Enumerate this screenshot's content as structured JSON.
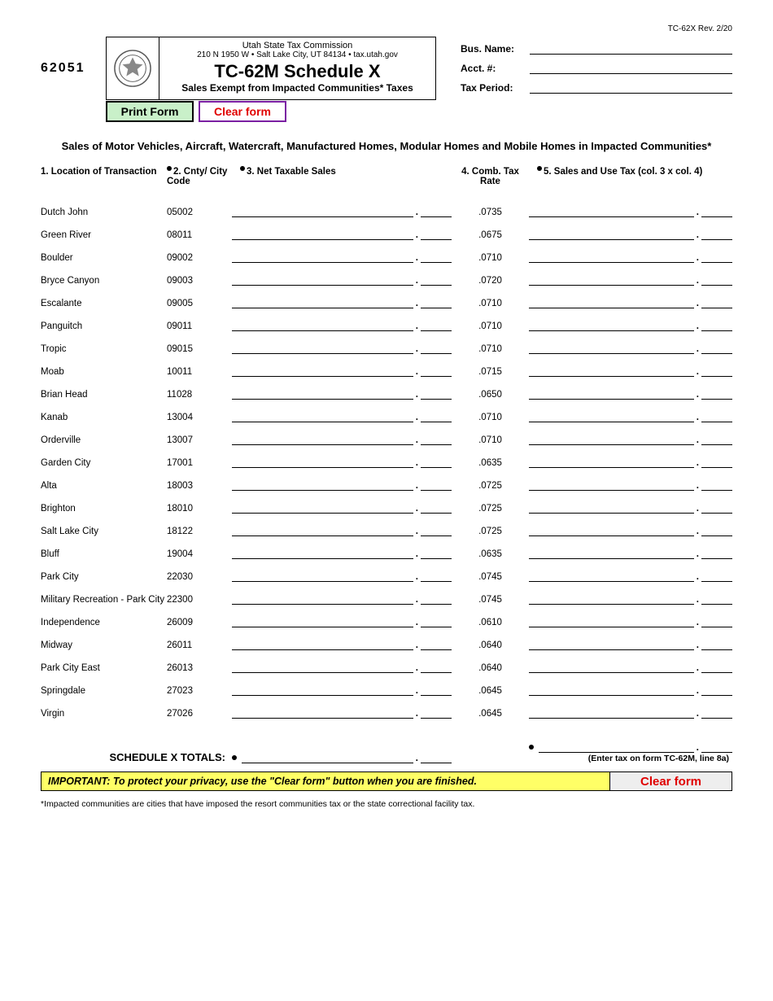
{
  "form_id_top": "TC-62X    Rev. 2/20",
  "left_code": "62051",
  "title": {
    "agency": "Utah State Tax Commission",
    "address": "210 N 1950 W  •  Salt Lake City, UT 84134  •  tax.utah.gov",
    "main": "TC-62M Schedule X",
    "sub": "Sales Exempt from Impacted Communities* Taxes"
  },
  "meta": {
    "bus_name_label": "Bus. Name:",
    "acct_label": "Acct. #:",
    "tax_period_label": "Tax Period:"
  },
  "buttons": {
    "print": "Print Form",
    "clear": "Clear form"
  },
  "section_title": "Sales of Motor Vehicles, Aircraft, Watercraft, Manufactured Homes, Modular Homes and Mobile Homes in Impacted Communities*",
  "columns": {
    "c1": "1. Location of Transaction",
    "c2": "2. Cnty/ City Code",
    "c3": "3. Net Taxable Sales",
    "c4": "4. Comb. Tax Rate",
    "c5": "5. Sales and Use Tax (col. 3 x col. 4)"
  },
  "rows": [
    {
      "loc": "Dutch John",
      "code": "05002",
      "rate": ".0735"
    },
    {
      "loc": "Green River",
      "code": "08011",
      "rate": ".0675"
    },
    {
      "loc": "Boulder",
      "code": "09002",
      "rate": ".0710"
    },
    {
      "loc": "Bryce Canyon",
      "code": "09003",
      "rate": ".0720"
    },
    {
      "loc": "Escalante",
      "code": "09005",
      "rate": ".0710"
    },
    {
      "loc": "Panguitch",
      "code": "09011",
      "rate": ".0710"
    },
    {
      "loc": "Tropic",
      "code": "09015",
      "rate": ".0710"
    },
    {
      "loc": "Moab",
      "code": "10011",
      "rate": ".0715"
    },
    {
      "loc": "Brian Head",
      "code": "11028",
      "rate": ".0650"
    },
    {
      "loc": "Kanab",
      "code": "13004",
      "rate": ".0710"
    },
    {
      "loc": "Orderville",
      "code": "13007",
      "rate": ".0710"
    },
    {
      "loc": "Garden City",
      "code": "17001",
      "rate": ".0635"
    },
    {
      "loc": "Alta",
      "code": "18003",
      "rate": ".0725"
    },
    {
      "loc": "Brighton",
      "code": "18010",
      "rate": ".0725"
    },
    {
      "loc": "Salt Lake City",
      "code": "18122",
      "rate": ".0725"
    },
    {
      "loc": "Bluff",
      "code": "19004",
      "rate": ".0635"
    },
    {
      "loc": "Park City",
      "code": "22030",
      "rate": ".0745"
    },
    {
      "loc": "Military Recreation - Park City",
      "code": "22300",
      "rate": ".0745"
    },
    {
      "loc": "Independence",
      "code": "26009",
      "rate": ".0610"
    },
    {
      "loc": "Midway",
      "code": "26011",
      "rate": ".0640"
    },
    {
      "loc": "Park City East",
      "code": "26013",
      "rate": ".0640"
    },
    {
      "loc": "Springdale",
      "code": "27023",
      "rate": ".0645"
    },
    {
      "loc": "Virgin",
      "code": "27026",
      "rate": ".0645"
    }
  ],
  "totals": {
    "label": "SCHEDULE X TOTALS:",
    "note": "(Enter tax on form TC-62M, line 8a)"
  },
  "warning": "IMPORTANT: To protect your privacy, use the \"Clear form\" button when you are finished.",
  "footnote": "*Impacted communities are cities that have imposed the resort communities tax or the state correctional facility tax."
}
